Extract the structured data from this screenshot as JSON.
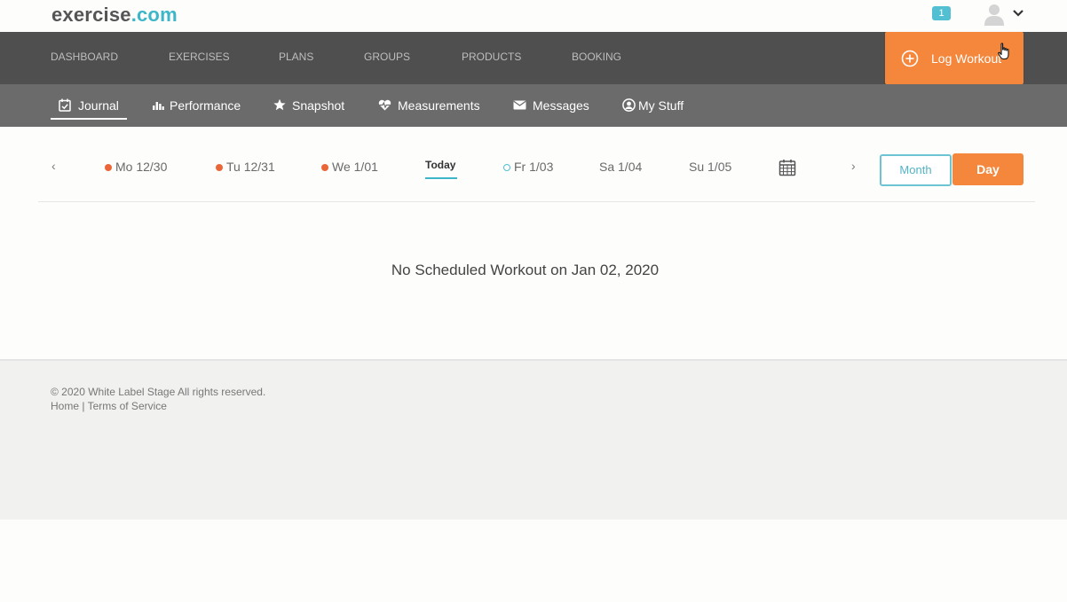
{
  "header": {
    "logo_part1": "exercise",
    "logo_part2": ".com",
    "notification_count": "1"
  },
  "main_nav": {
    "items": [
      "DASHBOARD",
      "EXERCISES",
      "PLANS",
      "GROUPS",
      "PRODUCTS",
      "BOOKING"
    ],
    "log_workout_label": "Log Workout"
  },
  "sub_nav": {
    "items": [
      {
        "label": "Journal",
        "icon": "calendar-check-icon",
        "active": true
      },
      {
        "label": "Performance",
        "icon": "bar-chart-icon"
      },
      {
        "label": "Snapshot",
        "icon": "star-icon"
      },
      {
        "label": "Measurements",
        "icon": "heartbeat-icon"
      },
      {
        "label": "Messages",
        "icon": "envelope-icon"
      },
      {
        "label": "My Stuff",
        "icon": "user-circle-icon"
      }
    ]
  },
  "day_strip": {
    "prev_arrow": "‹",
    "next_arrow": "›",
    "days": [
      {
        "label": "Mo 12/30",
        "marker": "filled"
      },
      {
        "label": "Tu 12/31",
        "marker": "filled"
      },
      {
        "label": "We 1/01",
        "marker": "filled"
      },
      {
        "label": "Today",
        "marker": "current"
      },
      {
        "label": "Fr 1/03",
        "marker": "empty"
      },
      {
        "label": "Sa 1/04",
        "marker": "none"
      },
      {
        "label": "Su 1/05",
        "marker": "none"
      }
    ],
    "view_month": "Month",
    "view_day": "Day"
  },
  "content": {
    "empty_message": "No Scheduled Workout on Jan 02, 2020"
  },
  "footer": {
    "copyright": "© 2020 White Label Stage All rights reserved.",
    "link_home": "Home",
    "separator": " | ",
    "link_terms": "Terms of Service"
  },
  "colors": {
    "accent_orange": "#f5873d",
    "accent_teal": "#3cb6c8",
    "dot_orange": "#ea6638",
    "nav_dark": "#4f4f4f",
    "subnav_gray": "#6b6b6b"
  }
}
